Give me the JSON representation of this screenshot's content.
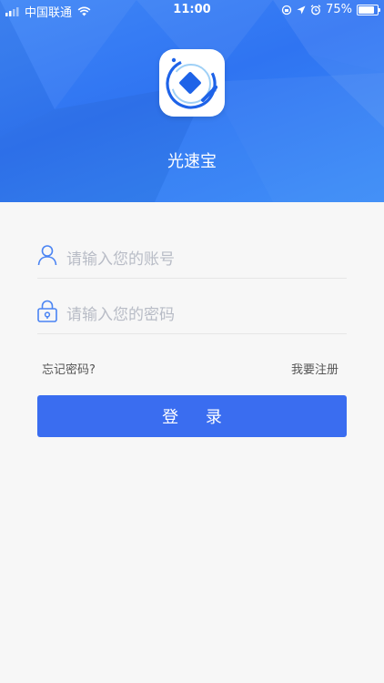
{
  "status_bar": {
    "carrier": "中国联通",
    "time": "11:00",
    "battery": "75%",
    "battery_level": 0.75
  },
  "app": {
    "name": "光速宝",
    "icon": "app-logo-icon"
  },
  "login_form": {
    "account_placeholder": "请输入您的账号",
    "password_placeholder": "请输入您的密码",
    "forgot_password": "忘记密码?",
    "register": "我要注册",
    "login_button": "登 录"
  },
  "icons": {
    "user": "user-icon",
    "lock": "lock-icon"
  },
  "colors": {
    "header_blue": "#2f74f2",
    "primary_button": "#3a6df0",
    "icon_blue": "#4a84f3",
    "background": "#f7f7f7"
  }
}
